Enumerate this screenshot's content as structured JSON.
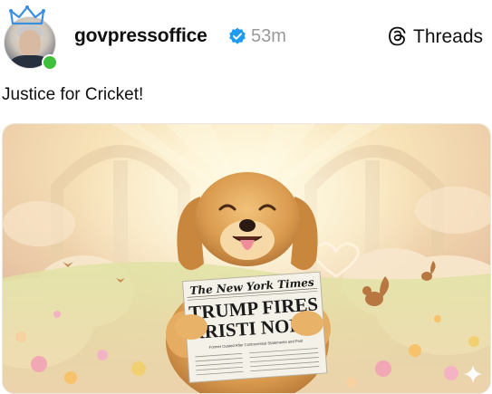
{
  "post": {
    "username": "govpressoffice",
    "timestamp": "53m",
    "platform_label": "Threads",
    "text": "Justice for Cricket!"
  },
  "image": {
    "newspaper_masthead": "The New York Times",
    "headline_line1": "TRUMP FIRES",
    "headline_line2": "KRISTI NOEM",
    "subheadline": "Former Ousted After Controversial Statements and Post",
    "icons": [
      "crown-icon",
      "verified-badge-icon",
      "threads-logo-icon",
      "sparkle-icon"
    ]
  },
  "colors": {
    "verified": "#1d9bf0",
    "online": "#3fbf3a",
    "muted": "#999999"
  }
}
